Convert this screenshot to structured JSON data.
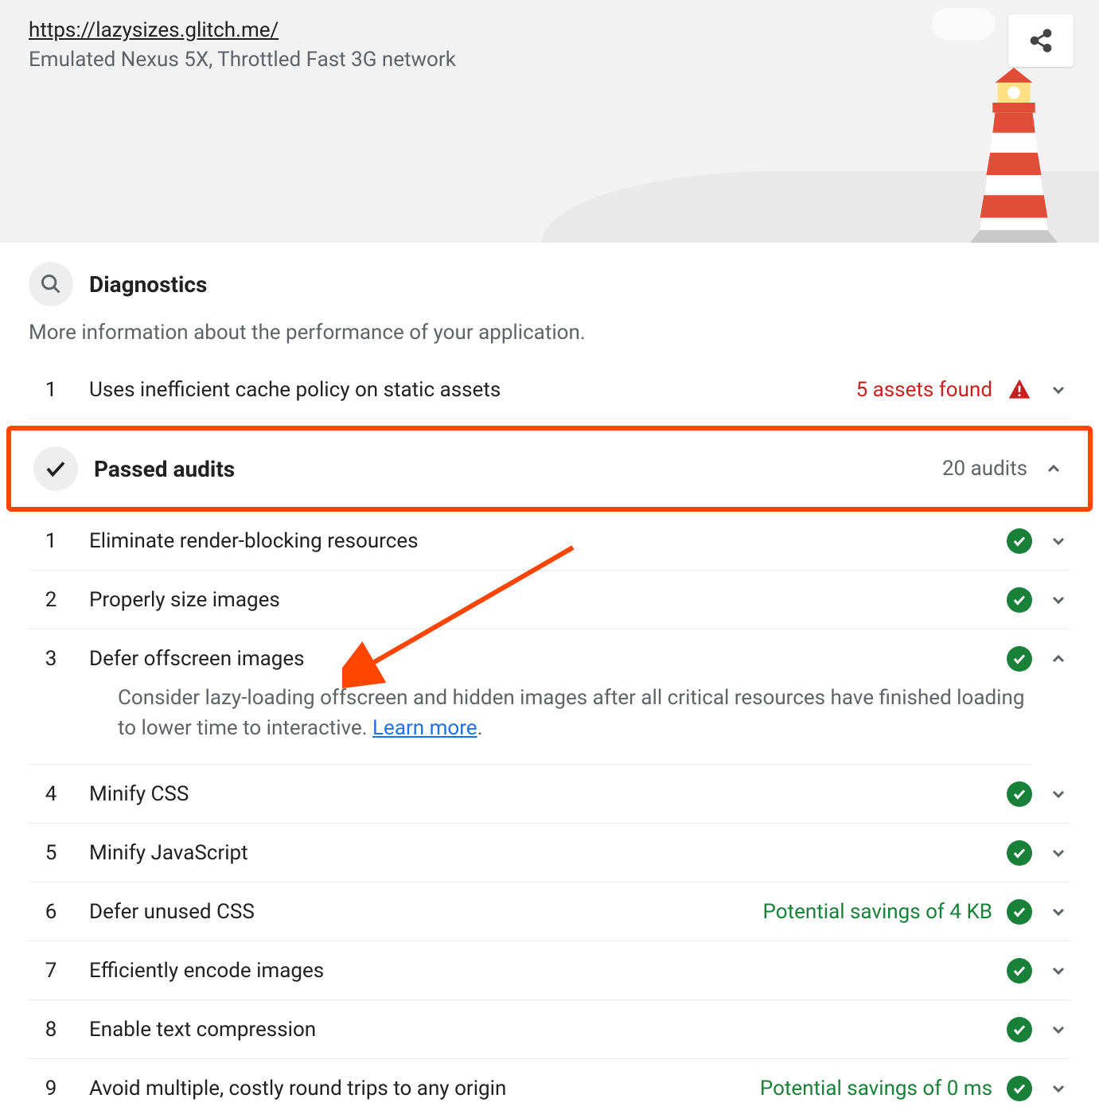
{
  "header": {
    "url": "https://lazysizes.glitch.me/",
    "subtitle": "Emulated Nexus 5X, Throttled Fast 3G network"
  },
  "diagnostics": {
    "title": "Diagnostics",
    "description": "More information about the performance of your application.",
    "items": [
      {
        "num": "1",
        "title": "Uses inefficient cache policy on static assets",
        "badge": "5 assets found",
        "badge_class": "badge-red",
        "icon": "warn",
        "chev": "down"
      }
    ]
  },
  "passed": {
    "title": "Passed audits",
    "count": "20 audits",
    "items": [
      {
        "num": "1",
        "title": "Eliminate render-blocking resources",
        "chev": "down",
        "expanded": false
      },
      {
        "num": "2",
        "title": "Properly size images",
        "chev": "down",
        "expanded": false
      },
      {
        "num": "3",
        "title": "Defer offscreen images",
        "chev": "up",
        "expanded": true,
        "detail": "Consider lazy-loading offscreen and hidden images after all critical resources have finished loading to lower time to interactive. ",
        "link_text": "Learn more"
      },
      {
        "num": "4",
        "title": "Minify CSS",
        "chev": "down",
        "expanded": false
      },
      {
        "num": "5",
        "title": "Minify JavaScript",
        "chev": "down",
        "expanded": false
      },
      {
        "num": "6",
        "title": "Defer unused CSS",
        "badge": "Potential savings of 4 KB",
        "chev": "down",
        "expanded": false
      },
      {
        "num": "7",
        "title": "Efficiently encode images",
        "chev": "down",
        "expanded": false
      },
      {
        "num": "8",
        "title": "Enable text compression",
        "chev": "down",
        "expanded": false
      },
      {
        "num": "9",
        "title": "Avoid multiple, costly round trips to any origin",
        "badge": "Potential savings of 0 ms",
        "chev": "down",
        "expanded": false
      }
    ]
  }
}
